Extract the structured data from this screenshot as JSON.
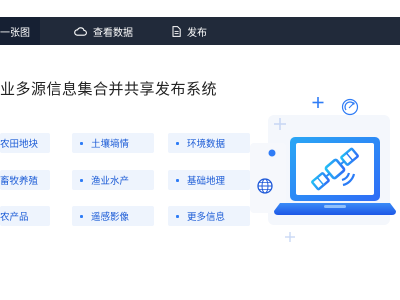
{
  "nav": {
    "items": [
      {
        "label": "一张图",
        "icon": "map-icon"
      },
      {
        "label": "查看数据",
        "icon": "cloud-icon"
      },
      {
        "label": "发布",
        "icon": "document-icon"
      }
    ]
  },
  "hero": {
    "title": "业多源信息集合并共享发布系统"
  },
  "categories": [
    {
      "label": "农田地块"
    },
    {
      "label": "土壤墒情"
    },
    {
      "label": "环境数据"
    },
    {
      "label": "畜牧养殖"
    },
    {
      "label": "渔业水产"
    },
    {
      "label": "基础地理"
    },
    {
      "label": "农产品"
    },
    {
      "label": "遥感影像"
    },
    {
      "label": "更多信息"
    }
  ],
  "colors": {
    "nav_bg": "#212a3a",
    "accent": "#2f7cf6",
    "chip_bg": "#eef4fd",
    "chip_text": "#1b5bd6"
  },
  "illustration": {
    "icons": [
      "laptop-icon",
      "satellite-icon",
      "globe-icon",
      "satellite-dish-icon",
      "plus-icon"
    ]
  }
}
